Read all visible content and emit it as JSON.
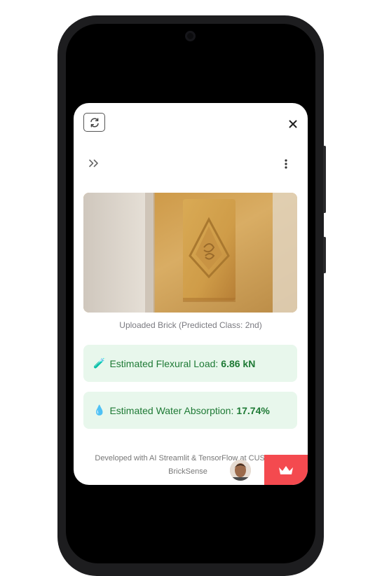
{
  "toolbar": {
    "refresh_icon": "refresh-icon",
    "close_icon": "close-icon",
    "expand_icon": "double-chevron-right-icon",
    "menu_icon": "vertical-dots-icon"
  },
  "main": {
    "image_caption": "Uploaded Brick (Predicted Class: 2nd)",
    "results": [
      {
        "emoji": "🧪",
        "label": "Estimated Flexural Load:",
        "value": "6.86 kN"
      },
      {
        "emoji": "💧",
        "label": "Estimated Water Absorption:",
        "value": "17.74%"
      }
    ]
  },
  "footer": {
    "line1": "Developed with AI Streamlit & TensorFlow at CUST",
    "line2": "BrickSense",
    "badge_icon": "crown-icon"
  },
  "colors": {
    "success_bg": "#e8f7ec",
    "success_text": "#1e7a35",
    "badge_red": "#f44a4f"
  }
}
